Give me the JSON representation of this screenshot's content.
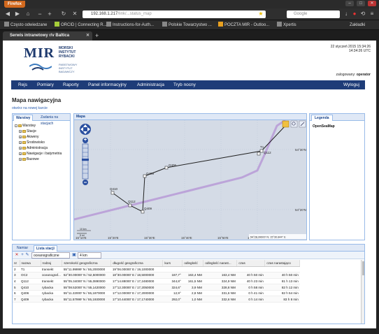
{
  "browser": {
    "app_button": "Firefox",
    "url_host": "192.168.1.217",
    "url_path": "/link/...status_map",
    "search_placeholder": "Google",
    "bookmarks": [
      "Często odwiedzane",
      "ORCID | Connecting R...",
      "Instructions-for-Auth...",
      "Polskie Towarzystwo ...",
      "POCZTA MIR - Outloo...",
      "Xpertis"
    ],
    "bookmarks_menu": "Zakładki",
    "tab_title": "Serwis intranetowy r/v Baltica",
    "new_tab": "+"
  },
  "header": {
    "logo_mir": "MIR",
    "logo_lines": [
      "MORSKI",
      "INSTYTUT",
      "RYBACKI"
    ],
    "logo_sub": [
      "PAŃSTWOWY",
      "INSTYTUT",
      "BADAWCZY"
    ],
    "date": "22 styczeń 2015 15:34:26",
    "time_utc": "14:34:26 UTC",
    "logged_label": "zalogowany:",
    "logged_user": "operator"
  },
  "menu": {
    "items": [
      "Rejs",
      "Pomiary",
      "Raporty",
      "Panel informacyjny",
      "Administracja",
      "Tryb nocny"
    ],
    "logout": "Wyloguj"
  },
  "page": {
    "title": "Mapa nawigacyjna",
    "open_new_tab": "otwórz na nowej karcie"
  },
  "left_panel": {
    "tabs": [
      "Warstwy",
      "Zadania na stacjach"
    ],
    "tree": [
      "Warstwy",
      "Stacje",
      "Akweny",
      "Środowisko",
      "Administracja",
      "Nawigacje i batymetria",
      "Bazowe"
    ]
  },
  "map": {
    "header": "Mapa",
    "lat_labels": [
      "54°30'N",
      "54°20'N"
    ],
    "lon_labels": [
      "15°10'E",
      "15°20'E",
      "15°30'E",
      "15°40'E",
      "15°50'E",
      "16°00'E"
    ],
    "station_labels": [
      "T1",
      "Q112",
      "Q406",
      "Q409",
      "Q410",
      "Q112",
      "Q409"
    ],
    "scale_km": "10 km",
    "scale_mi": "5 mi",
    "coord_readout": "54°28.39600' N; 15°30.844'' E",
    "route_color": "#222222",
    "ship_track_color": "#b79ad6"
  },
  "legend": {
    "tab": "Legenda",
    "layer": "OpenSeaMap"
  },
  "bottom": {
    "tabs": [
      "Namiar",
      "Lista stacji"
    ],
    "toolbar_select": "oceanograficzne",
    "toolbar_unit": "4 km",
    "columns": [
      "nr",
      "nazwa",
      "rodzaj",
      "szerokość geograficzna",
      "długość geograficzna",
      "kurs",
      "odległość",
      "odległość narast...",
      "czas",
      "czas narastająco"
    ],
    "rows": [
      [
        "2",
        "T1",
        "transekt",
        "55°11.99999' N / 55,2000000",
        "19°06.00000' E / 19,1000000",
        "",
        "",
        "",
        "",
        ""
      ],
      [
        "3",
        "OC2",
        "oceanograf...",
        "52°30.00000' N / 52,5000000",
        "18°30.00000' E / 18,5000000",
        "187,7°",
        "163,4 NM",
        "163,4 NM",
        "40 h 50 min",
        "40 h 50 min"
      ],
      [
        "4",
        "Q112",
        "transekt",
        "55°05.34000' N / 55,0890000",
        "17°14.88000' E / 17,2480000",
        "344,8°",
        "161,5 NM",
        "324,9 NM",
        "40 h 23 min",
        "81 h 13 min"
      ],
      [
        "5",
        "Q410",
        "rybacka",
        "55°08.52000' N / 55,1420000",
        "17°12.30000' E / 17,2050000",
        "324,6°",
        "3,9 NM",
        "328,8 NM",
        "0 h 58 min",
        "82 h 12 min"
      ],
      [
        "6",
        "Q406",
        "rybacka",
        "55°11.22000' N / 55,1870000",
        "17°12.00000' E / 17,2000000",
        "12,9°",
        "2,8 NM",
        "331,6 NM",
        "0 h 41 min",
        "82 h 54 min"
      ],
      [
        "7",
        "Q409",
        "rybacka",
        "55°11.57999' N / 55,1930000",
        "17°10.44000' E / 17,1740000",
        "292,0°",
        "1,0 NM",
        "332,6 NM",
        "0 h 14 min",
        "83 h 8 min"
      ]
    ]
  }
}
